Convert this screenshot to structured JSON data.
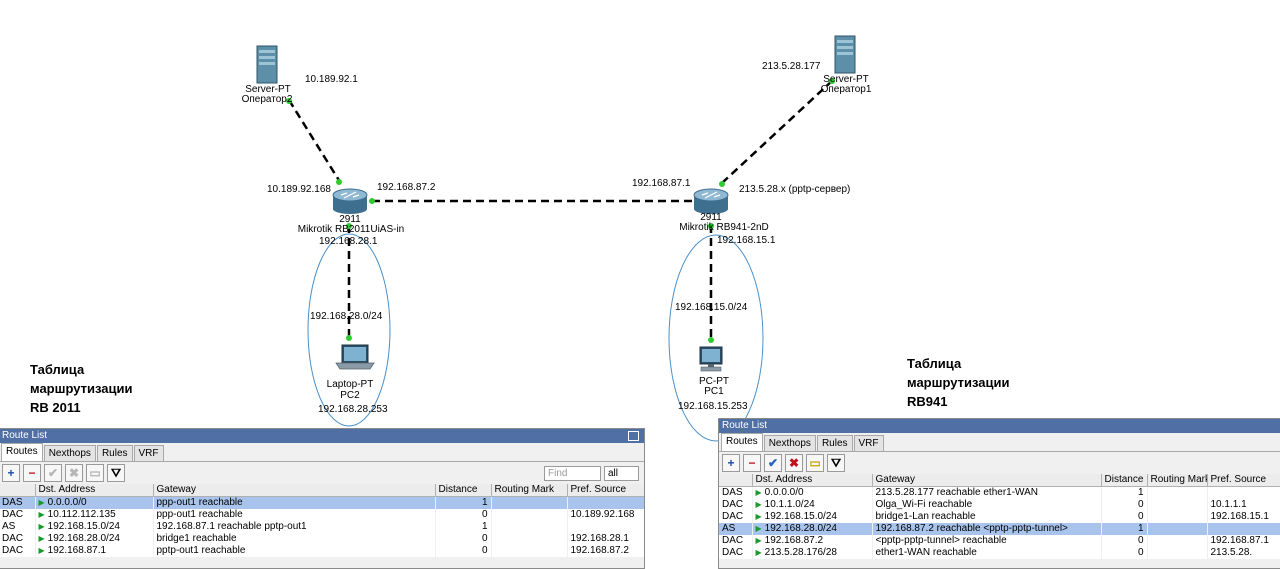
{
  "diagram": {
    "server_left": {
      "type": "Server-PT",
      "name": "Оператор2",
      "ip": "10.189.92.1"
    },
    "server_right": {
      "type": "Server-PT",
      "name": "Оператор1",
      "ip": "213.5.28.177"
    },
    "router_left": {
      "model": "2911",
      "name": "Mikrotik RB2011UiAS-in",
      "ip_wan": "10.189.92.168",
      "ip_tunnel": "192.168.87.2",
      "ip_lan": "192.168.28.1"
    },
    "router_right": {
      "model": "2911",
      "name": "Mikrotik RB941-2nD",
      "ip_tunnel": "192.168.87.1",
      "ip_wan": "213.5.28.x (pptp-сервер)",
      "ip_lan": "192.168.15.1"
    },
    "laptop": {
      "type": "Laptop-PT",
      "name": "PC2",
      "network": "192.168.28.0/24",
      "ip": "192.168.28.253"
    },
    "pc": {
      "type": "PC-PT",
      "name": "PC1",
      "network": "192.168.15.0/24",
      "ip": "192.168.15.253"
    }
  },
  "captions": {
    "left": [
      "Таблица",
      "маршрутизации",
      "RB 2011"
    ],
    "right": [
      "Таблица",
      "маршрутизации",
      "RB941"
    ]
  },
  "route_list_left": {
    "title": "Route List",
    "tabs": [
      "Routes",
      "Nexthops",
      "Rules",
      "VRF"
    ],
    "find_placeholder": "Find",
    "filter": "all",
    "columns": [
      "",
      "Dst. Address",
      "Gateway",
      "Distance",
      "Routing Mark",
      "Pref. Source"
    ],
    "rows": [
      {
        "flags": "DAS",
        "dst": "0.0.0.0/0",
        "gateway": "ppp-out1 reachable",
        "distance": "1",
        "mark": "",
        "pref": "",
        "selected": true
      },
      {
        "flags": "DAC",
        "dst": "10.112.112.135",
        "gateway": "ppp-out1 reachable",
        "distance": "0",
        "mark": "",
        "pref": "10.189.92.168",
        "selected": false
      },
      {
        "flags": "AS",
        "dst": "192.168.15.0/24",
        "gateway": "192.168.87.1 reachable pptp-out1",
        "distance": "1",
        "mark": "",
        "pref": "",
        "selected": false
      },
      {
        "flags": "DAC",
        "dst": "192.168.28.0/24",
        "gateway": "bridge1 reachable",
        "distance": "0",
        "mark": "",
        "pref": "192.168.28.1",
        "selected": false
      },
      {
        "flags": "DAC",
        "dst": "192.168.87.1",
        "gateway": "pptp-out1 reachable",
        "distance": "0",
        "mark": "",
        "pref": "192.168.87.2",
        "selected": false
      }
    ]
  },
  "route_list_right": {
    "title": "Route List",
    "tabs": [
      "Routes",
      "Nexthops",
      "Rules",
      "VRF"
    ],
    "columns": [
      "",
      "Dst. Address",
      "Gateway",
      "Distance",
      "Routing Mark",
      "Pref. Source"
    ],
    "rows": [
      {
        "flags": "DAS",
        "dst": "0.0.0.0/0",
        "gateway": "213.5.28.177 reachable ether1-WAN",
        "distance": "1",
        "mark": "",
        "pref": "",
        "selected": false
      },
      {
        "flags": "DAC",
        "dst": "10.1.1.0/24",
        "gateway": "Olga_Wi-Fi reachable",
        "distance": "0",
        "mark": "",
        "pref": "10.1.1.1",
        "selected": false
      },
      {
        "flags": "DAC",
        "dst": "192.168.15.0/24",
        "gateway": "bridge1-Lan reachable",
        "distance": "0",
        "mark": "",
        "pref": "192.168.15.1",
        "selected": false
      },
      {
        "flags": "AS",
        "dst": "192.168.28.0/24",
        "gateway": "192.168.87.2 reachable <pptp-pptp-tunnel>",
        "distance": "1",
        "mark": "",
        "pref": "",
        "selected": true
      },
      {
        "flags": "DAC",
        "dst": "192.168.87.2",
        "gateway": "<pptp-pptp-tunnel> reachable",
        "distance": "0",
        "mark": "",
        "pref": "192.168.87.1",
        "selected": false
      },
      {
        "flags": "DAC",
        "dst": "213.5.28.176/28",
        "gateway": "ether1-WAN reachable",
        "distance": "0",
        "mark": "",
        "pref": "213.5.28.",
        "selected": false
      }
    ]
  },
  "colors": {
    "link": "#000000",
    "port": "#2ecc2e",
    "router": "#5a8fb0",
    "lan_ellipse": "#4a90c8",
    "selected_row": "#a9c4ec",
    "title_bar": "#4f6fa5"
  }
}
